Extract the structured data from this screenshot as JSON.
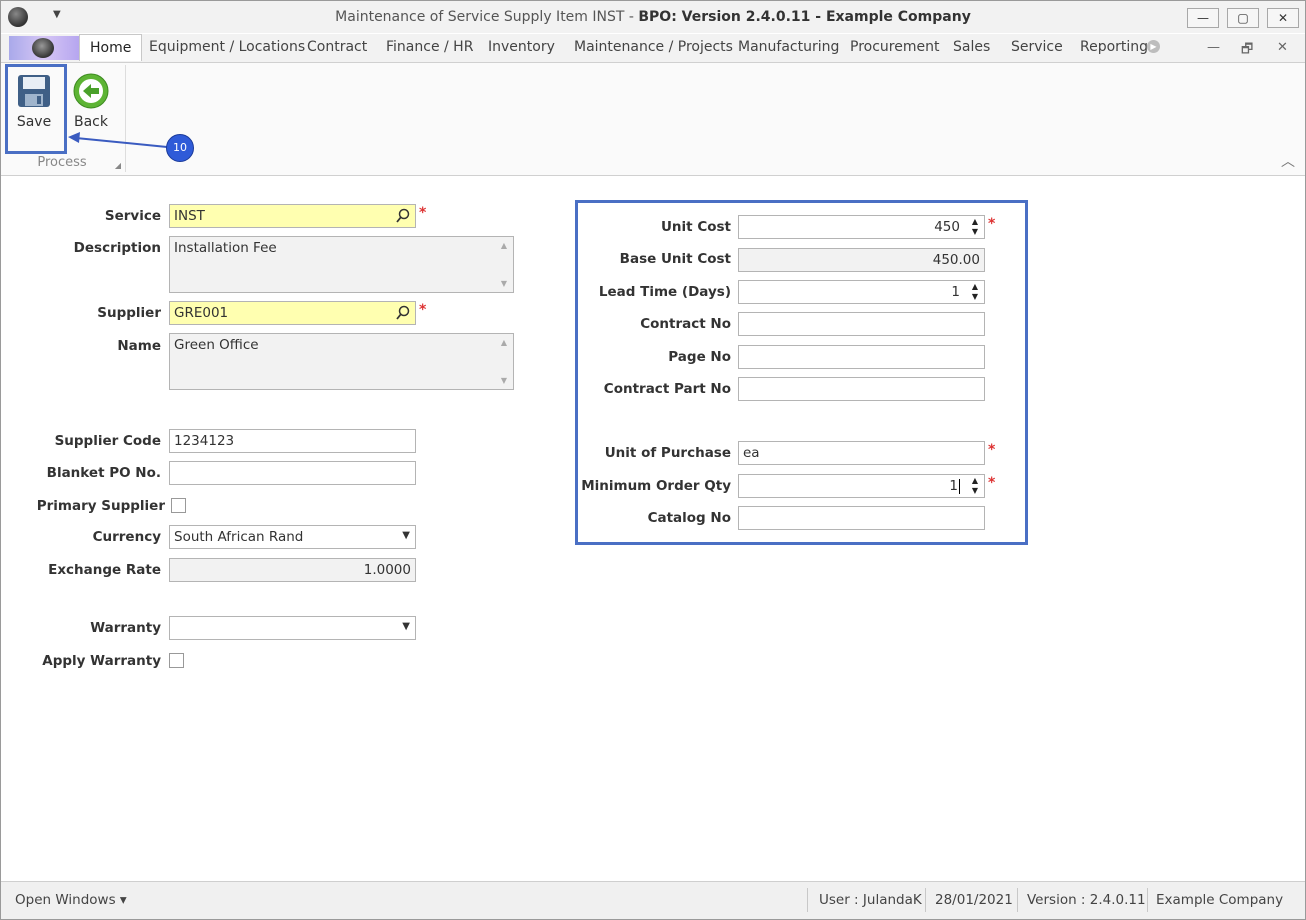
{
  "window": {
    "title_prefix": "Maintenance of Service Supply Item INST - ",
    "title_suffix": "BPO: Version 2.4.0.11 - Example Company",
    "minimize": "—",
    "maximize": "▢",
    "close": "✕"
  },
  "tabs": [
    {
      "label": "Home",
      "active": true
    },
    {
      "label": "Equipment / Locations"
    },
    {
      "label": "Contract"
    },
    {
      "label": "Finance / HR"
    },
    {
      "label": "Inventory"
    },
    {
      "label": "Maintenance / Projects"
    },
    {
      "label": "Manufacturing"
    },
    {
      "label": "Procurement"
    },
    {
      "label": "Sales"
    },
    {
      "label": "Service"
    },
    {
      "label": "Reporting"
    }
  ],
  "mdi": {
    "minimize": "—",
    "restore": "🗗",
    "close": "✕"
  },
  "ribbon": {
    "save_label": "Save",
    "back_label": "Back",
    "group_label": "Process",
    "callout_number": "10"
  },
  "form_left": {
    "service_label": "Service",
    "service_value": "INST",
    "description_label": "Description",
    "description_value": "Installation Fee",
    "supplier_label": "Supplier",
    "supplier_value": "GRE001",
    "name_label": "Name",
    "name_value": "Green Office",
    "supplier_code_label": "Supplier Code",
    "supplier_code_value": "1234123",
    "blanket_po_label": "Blanket PO No.",
    "blanket_po_value": "",
    "primary_supplier_label": "Primary Supplier",
    "primary_supplier_checked": false,
    "currency_label": "Currency",
    "currency_value": "South African Rand",
    "exchange_rate_label": "Exchange Rate",
    "exchange_rate_value": "1.0000",
    "warranty_label": "Warranty",
    "warranty_value": "",
    "apply_warranty_label": "Apply Warranty",
    "apply_warranty_checked": false
  },
  "form_right": {
    "unit_cost_label": "Unit Cost",
    "unit_cost_value": "450",
    "base_unit_cost_label": "Base Unit Cost",
    "base_unit_cost_value": "450.00",
    "lead_time_label": "Lead Time (Days)",
    "lead_time_value": "1",
    "contract_no_label": "Contract No",
    "contract_no_value": "",
    "page_no_label": "Page No",
    "page_no_value": "",
    "contract_part_no_label": "Contract Part No",
    "contract_part_no_value": "",
    "unit_of_purchase_label": "Unit of Purchase",
    "unit_of_purchase_value": "ea",
    "min_order_qty_label": "Minimum Order Qty",
    "min_order_qty_value": "1",
    "catalog_no_label": "Catalog No",
    "catalog_no_value": ""
  },
  "required_mark": "*",
  "statusbar": {
    "open_windows": "Open Windows ▾",
    "user": "User : JulandaK",
    "date": "28/01/2021",
    "version": "Version : 2.4.0.11",
    "company": "Example Company"
  },
  "colors": {
    "highlight": "#4a6fc4",
    "callout": "#2f5bd8",
    "required": "#dd3333",
    "lookup_bg": "#ffffb0"
  }
}
